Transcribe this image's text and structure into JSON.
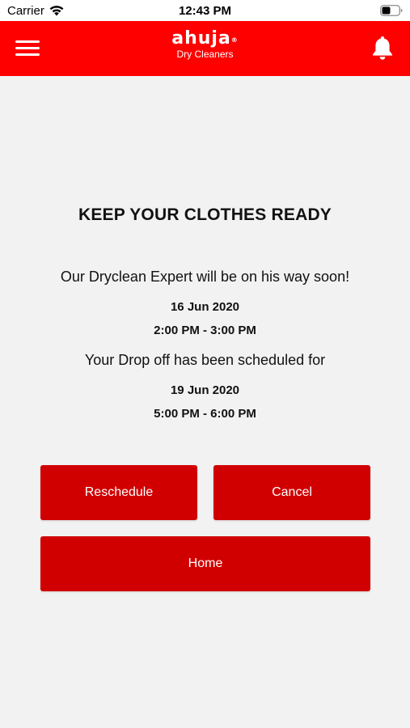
{
  "status_bar": {
    "carrier": "Carrier",
    "time": "12:43 PM",
    "wifi_icon": "wifi-icon",
    "battery_icon": "battery-icon"
  },
  "header": {
    "background_color": "#ff0000",
    "menu_icon": "hamburger-menu-icon",
    "logo_text": "ahuja",
    "logo_registered": "®",
    "logo_subtitle": "Dry Cleaners",
    "bell_icon": "bell-icon"
  },
  "main": {
    "title": "KEEP YOUR CLOTHES READY",
    "pickup_message": "Our Dryclean Expert will be on his way soon!",
    "pickup_date": "16 Jun 2020",
    "pickup_time": "2:00 PM - 3:00 PM",
    "dropoff_message": "Your Drop off has been scheduled for",
    "dropoff_date": "19 Jun 2020",
    "dropoff_time": "5:00 PM - 6:00 PM"
  },
  "buttons": {
    "reschedule_label": "Reschedule",
    "cancel_label": "Cancel",
    "home_label": "Home",
    "button_color": "#d10000"
  }
}
